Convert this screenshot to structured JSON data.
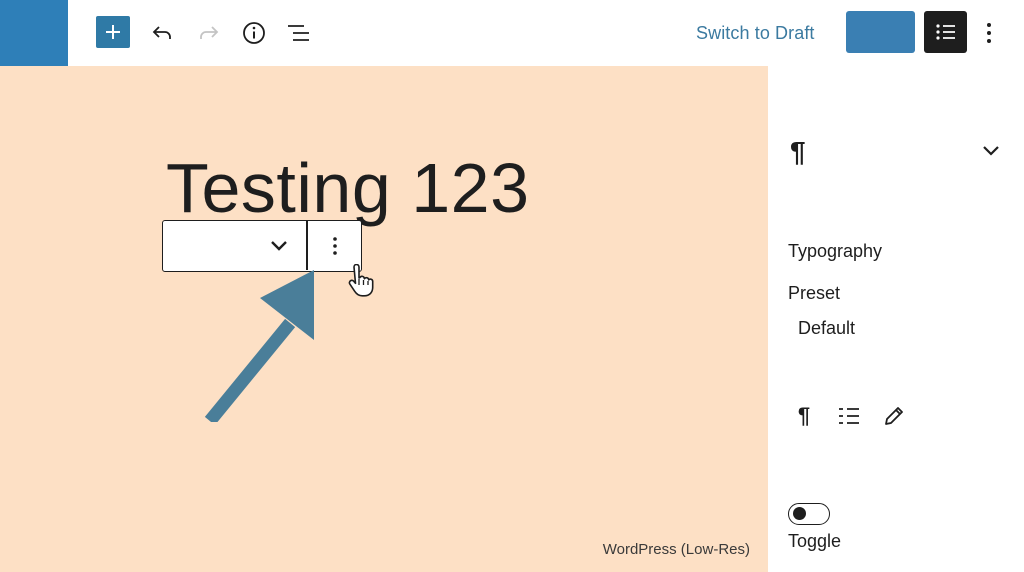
{
  "toolbar": {
    "add_icon": "plus-icon",
    "undo_icon": "undo-icon",
    "redo_icon": "redo-icon",
    "info_icon": "info-icon",
    "outline_icon": "list-view-icon",
    "switch_draft_label": "Switch to Draft",
    "settings_icon": "settings-list-icon",
    "options_icon": "kebab-menu-icon"
  },
  "canvas": {
    "heading": "Testing 123",
    "watermark": "WordPress (Low-Res)",
    "block_toolbar": {
      "select_icon": "chevron-down-icon",
      "more_icon": "vertical-ellipsis-icon"
    },
    "cursor_icon": "hand-pointer-icon",
    "arrow_icon": "pointer-arrow-icon"
  },
  "sidebar": {
    "block_icon": "¶",
    "panel_icon": "chevron-down-icon",
    "typography_label": "Typography",
    "preset_label": "Preset",
    "preset_value": "Default",
    "tools": {
      "paragraph": "¶",
      "list_icon": "list-settings-icon",
      "pencil_icon": "pencil-icon"
    },
    "toggle_label": "Toggle",
    "toggle_on": false
  },
  "colors": {
    "brand": "#2e7fb8",
    "canvas_bg": "#fde0c5",
    "accent_text": "#3b7aa0",
    "dark": "#1e1e1e"
  }
}
